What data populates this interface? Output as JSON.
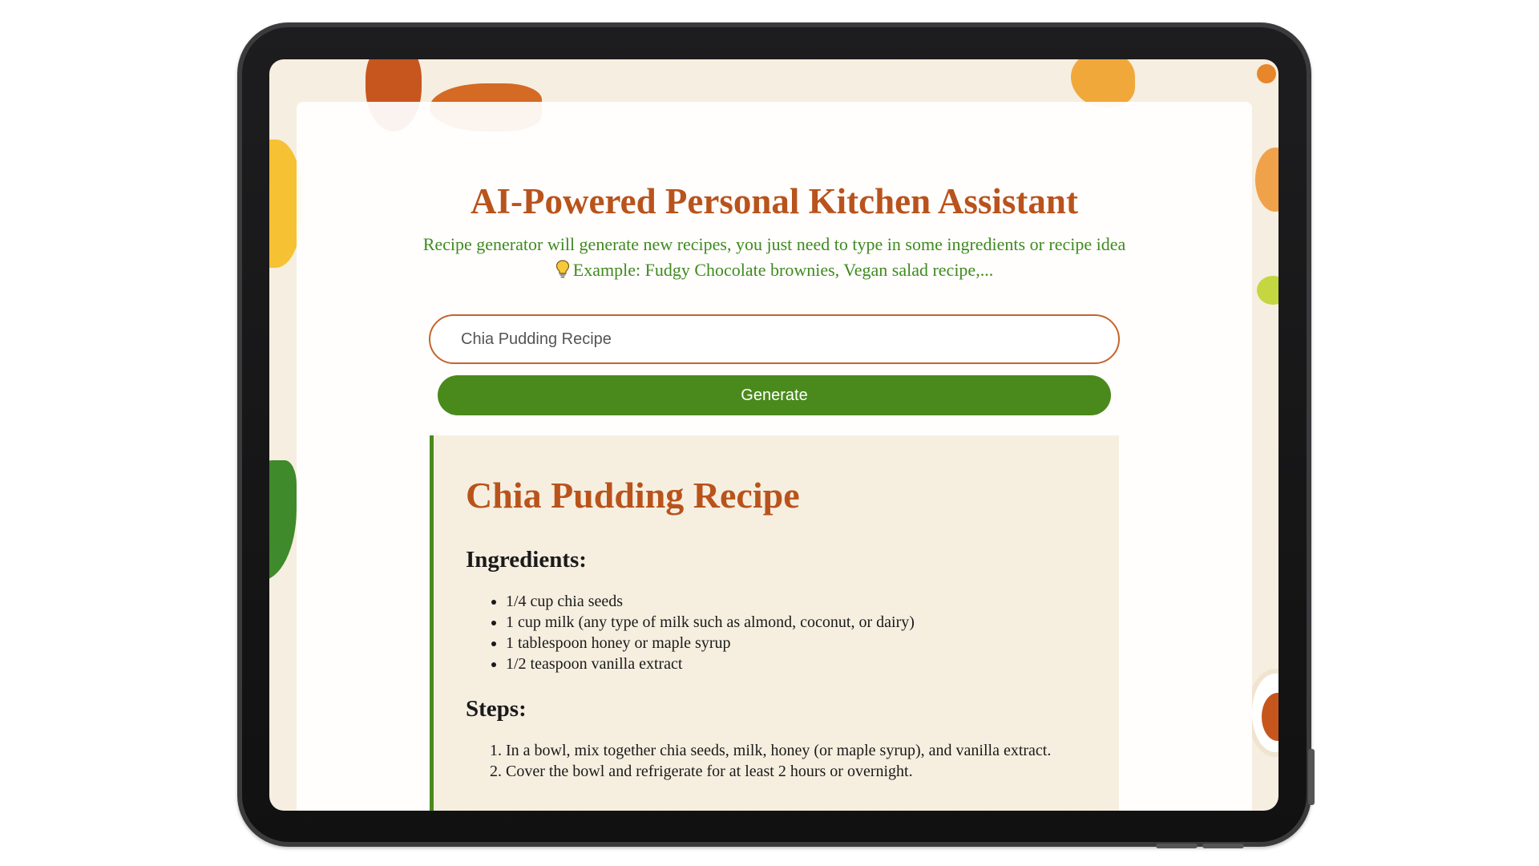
{
  "header": {
    "title": "AI-Powered Personal Kitchen Assistant",
    "description": "Recipe generator will generate new recipes, you just need to type in some ingredients or recipe idea",
    "example": "Example: Fudgy Chocolate brownies, Vegan salad recipe,..."
  },
  "form": {
    "input_value": "Chia Pudding Recipe",
    "generate_label": "Generate"
  },
  "recipe": {
    "title": "Chia Pudding Recipe",
    "ingredients_heading": "Ingredients:",
    "ingredients": [
      "1/4 cup chia seeds",
      "1 cup milk (any type of milk such as almond, coconut, or dairy)",
      "1 tablespoon honey or maple syrup",
      "1/2 teaspoon vanilla extract"
    ],
    "steps_heading": "Steps:",
    "steps": [
      "In a bowl, mix together chia seeds, milk, honey (or maple syrup), and vanilla extract.",
      "Cover the bowl and refrigerate for at least 2 hours or overnight."
    ]
  },
  "colors": {
    "accent_orange": "#b9531c",
    "accent_green": "#4a8a1c",
    "background": "#f6eee0"
  },
  "icons": {
    "bulb": "light-bulb-icon"
  }
}
